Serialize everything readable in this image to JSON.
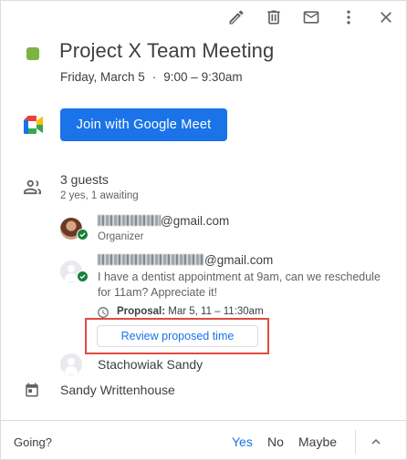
{
  "event": {
    "title": "Project X Team Meeting",
    "date": "Friday, March 5",
    "separator": "·",
    "time": "9:00 – 9:30am",
    "color": "#7cb342"
  },
  "toolbar": {
    "icons": [
      "edit-icon",
      "delete-icon",
      "email-icon",
      "more-options-icon",
      "close-icon"
    ]
  },
  "meet": {
    "button_label": "Join with Google Meet",
    "accent": "#1a73e8"
  },
  "guests": {
    "count_label": "3 guests",
    "status_label": "2 yes, 1 awaiting",
    "list": [
      {
        "email_suffix": "@gmail.com",
        "role": "Organizer"
      },
      {
        "email_suffix": "@gmail.com",
        "comment": "I have a dentist appointment at 9am, can we reschedule for 11am? Appreciate it!",
        "proposal_label": "Proposal:",
        "proposal_value": "Mar 5, 11 – 11:30am",
        "review_label": "Review proposed time"
      },
      {
        "name": "Stachowiak Sandy"
      }
    ]
  },
  "calendar": {
    "owner": "Sandy Writtenhouse"
  },
  "footer": {
    "going_label": "Going?",
    "yes_label": "Yes",
    "no_label": "No",
    "maybe_label": "Maybe",
    "selected": "Yes"
  }
}
